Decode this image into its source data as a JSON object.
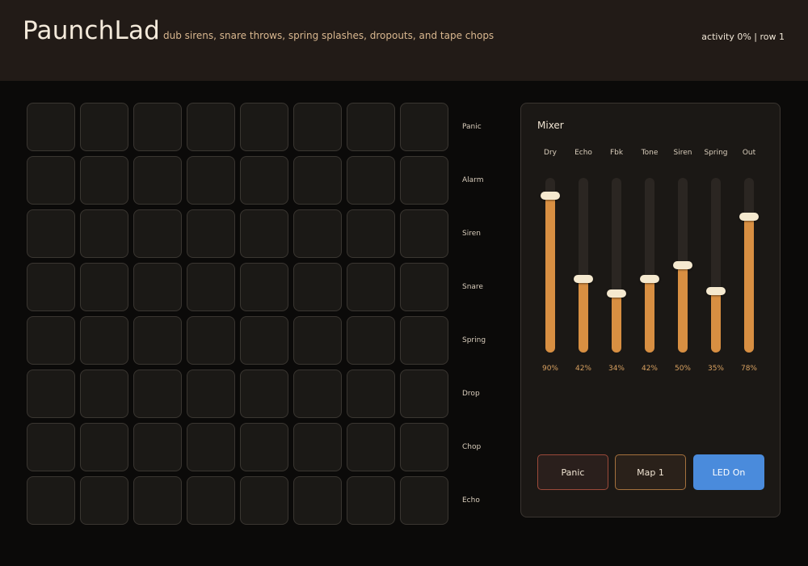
{
  "header": {
    "title": "PaunchLad",
    "subtitle": "dub sirens, snare throws, spring splashes, dropouts, and tape chops",
    "status": "activity 0% | row 1"
  },
  "pads": {
    "rows": 8,
    "cols": 8
  },
  "row_labels": [
    "Panic",
    "Alarm",
    "Siren",
    "Snare",
    "Spring",
    "Drop",
    "Chop",
    "Echo"
  ],
  "mixer": {
    "title": "Mixer",
    "channels": [
      {
        "label": "Dry",
        "value": 90,
        "display": "90%"
      },
      {
        "label": "Echo",
        "value": 42,
        "display": "42%"
      },
      {
        "label": "Fbk",
        "value": 34,
        "display": "34%"
      },
      {
        "label": "Tone",
        "value": 42,
        "display": "42%"
      },
      {
        "label": "Siren",
        "value": 50,
        "display": "50%"
      },
      {
        "label": "Spring",
        "value": 35,
        "display": "35%"
      },
      {
        "label": "Out",
        "value": 78,
        "display": "78%"
      }
    ],
    "buttons": {
      "panic": "Panic",
      "map": "Map 1",
      "led": "LED On"
    }
  },
  "colors": {
    "accent_fill": "#d88f42",
    "led_button": "#4a8bdc",
    "panic_border": "#9c4a3a",
    "map_border": "#a5713d"
  }
}
